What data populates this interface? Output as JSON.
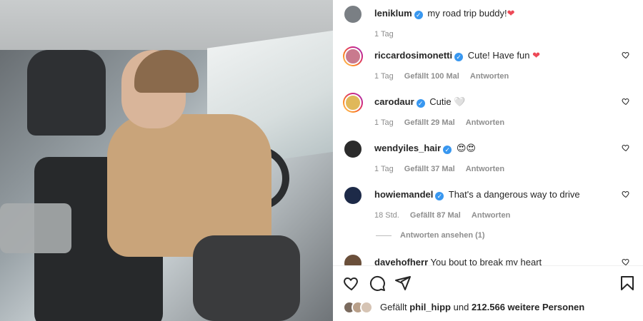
{
  "post": {
    "comments": [
      {
        "username": "leniklum",
        "text": "my road trip buddy!",
        "emoji": "❤",
        "time": "1 Tag",
        "likes": "",
        "reply": ""
      },
      {
        "username": "riccardosimonetti",
        "text": "Cute! Have fun",
        "emoji": "❤",
        "time": "1 Tag",
        "likes": "Gefällt 100 Mal",
        "reply": "Antworten"
      },
      {
        "username": "carodaur",
        "text": "Cutie",
        "emoji": "🤍",
        "time": "1 Tag",
        "likes": "Gefällt 29 Mal",
        "reply": "Antworten"
      },
      {
        "username": "wendyiles_hair",
        "text": "",
        "emoji": "😍😍",
        "time": "1 Tag",
        "likes": "Gefällt 37 Mal",
        "reply": "Antworten"
      },
      {
        "username": "howiemandel",
        "text": "That's a dangerous way to drive",
        "emoji": "",
        "time": "18 Std.",
        "likes": "Gefällt 87 Mal",
        "reply": "Antworten"
      },
      {
        "username": "davehofherr",
        "text": "You bout to break my heart",
        "emoji": "",
        "time": "",
        "likes": "",
        "reply": ""
      }
    ],
    "view_replies": "Antworten ansehen (1)",
    "liked_by": {
      "prefix": "Gefällt",
      "user": "phil_hipp",
      "connector": "und",
      "count": "212.566 weitere Personen"
    }
  },
  "icons": {
    "verified": "check-badge-icon",
    "like": "heart-icon",
    "comment": "comment-icon",
    "share": "send-icon",
    "save": "bookmark-icon"
  },
  "colors": {
    "verified": "#3897f0",
    "meta": "#8e8e8e",
    "text": "#262626"
  }
}
